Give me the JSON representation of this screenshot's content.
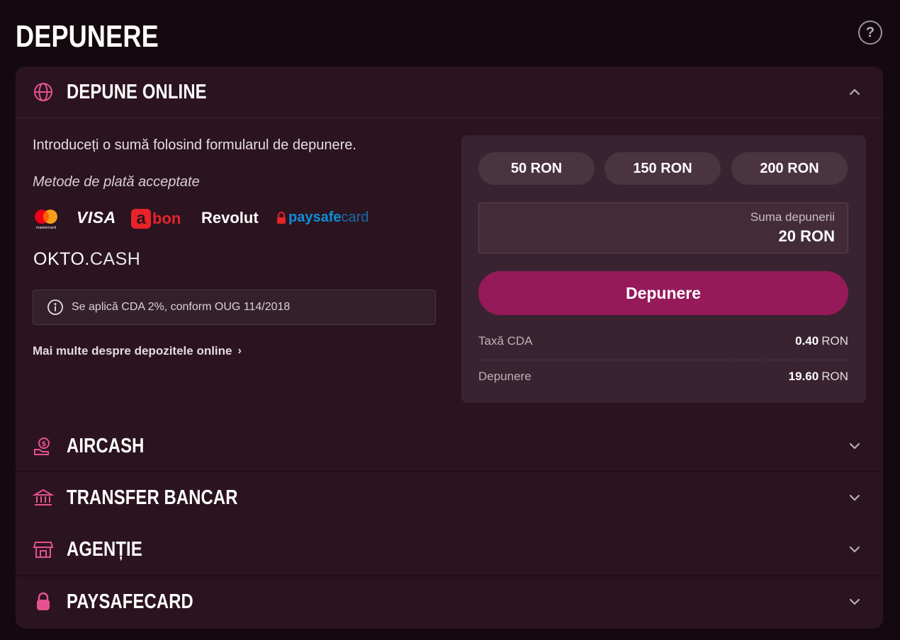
{
  "page": {
    "title": "DEPUNERE",
    "help_icon": "question-circle-icon",
    "help_label": "?"
  },
  "colors": {
    "background": "#150910",
    "panel": "#2b141f",
    "card": "#3a2330",
    "accent_pink": "#e4528f",
    "button": "#961a5a"
  },
  "sections": [
    {
      "title": "DEPUNE ONLINE",
      "icon": "globe-icon",
      "expanded": true
    },
    {
      "title": "AIRCASH",
      "icon": "money-hand-icon",
      "expanded": false
    },
    {
      "title": "TRANSFER BANCAR",
      "icon": "bank-icon",
      "expanded": false
    },
    {
      "title": "AGENȚIE",
      "icon": "store-icon",
      "expanded": false
    },
    {
      "title": "PAYSAFECARD",
      "icon": "lock-icon",
      "expanded": false
    }
  ],
  "online": {
    "intro": "Introduceți o sumă folosind formularul de depunere.",
    "methods_label": "Metode de plată acceptate",
    "logos": {
      "mastercard_text": "mastercard",
      "visa": "VISA",
      "abon_a": "a",
      "abon_rest": "bon",
      "revolut": "Revolut",
      "paysafe_pay": "paysafe",
      "paysafe_card": "card",
      "okto_main": "OKTO.",
      "okto_cash": "CASH"
    },
    "notice": "Se aplică CDA 2%, conform OUG 114/2018",
    "more_link": "Mai multe despre depozitele online",
    "more_arrow": "›"
  },
  "form": {
    "presets": [
      "50 RON",
      "150 RON",
      "200 RON"
    ],
    "amount_label": "Suma depunerii",
    "amount_value": "20 RON",
    "submit_label": "Depunere",
    "summary": [
      {
        "label": "Taxă CDA",
        "amount": "0.40",
        "currency": "RON"
      },
      {
        "label": "Depunere",
        "amount": "19.60",
        "currency": "RON"
      }
    ]
  }
}
